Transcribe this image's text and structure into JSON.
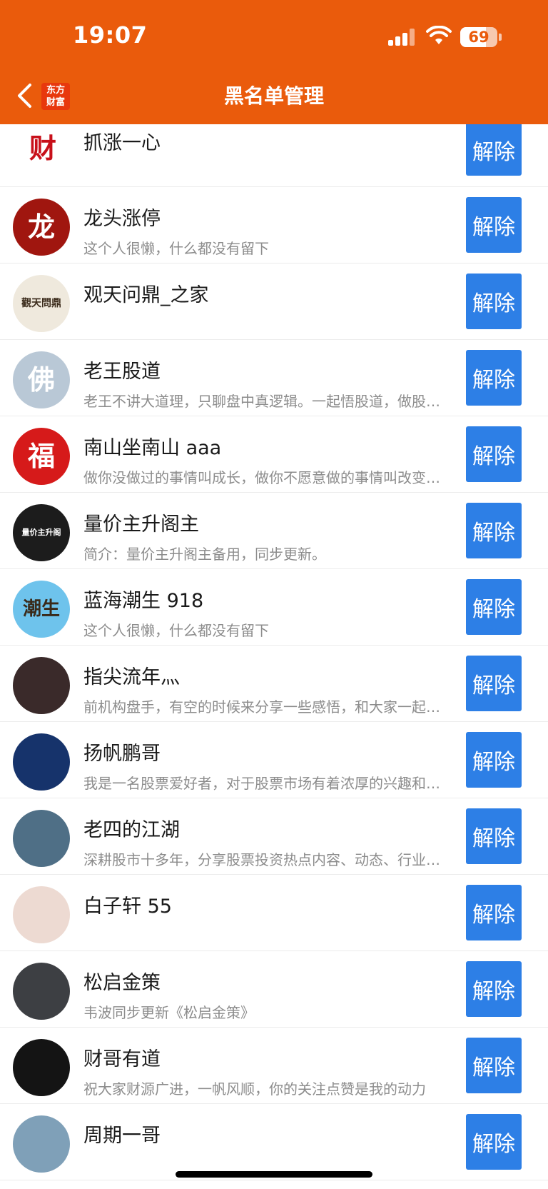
{
  "status_bar": {
    "time": "19:07",
    "battery": "69",
    "battery_level": 0.69
  },
  "header": {
    "title": "黑名单管理",
    "logo_line1": "东方",
    "logo_line2": "财富",
    "brand_color": "#ea5b0c"
  },
  "colors": {
    "button": "#2d7fe6",
    "desc_text": "#8c8c8c"
  },
  "unblock_label": "解除",
  "users": [
    {
      "name": "抓涨一心",
      "desc": "",
      "avatar_text": "财",
      "avatar_color": "#ffffff"
    },
    {
      "name": "龙头涨停",
      "desc": "这个人很懒，什么都没有留下",
      "avatar_text": "龙",
      "avatar_color": "#a0160f"
    },
    {
      "name": "观天问鼎_之家",
      "desc": "",
      "avatar_text": "觀天問鼎",
      "avatar_color": "#efe9dd"
    },
    {
      "name": "老王股道",
      "desc": "老王不讲大道理，只聊盘中真逻辑。一起悟股道，做股市中的明白人。",
      "avatar_text": "佛",
      "avatar_color": "#b9c8d6"
    },
    {
      "name": "南山坐南山 aaa",
      "desc": "做你没做过的事情叫成长，做你不愿意做的事情叫改变，做你不敢做的事情叫突破。",
      "avatar_text": "福",
      "avatar_color": "#d61a1a"
    },
    {
      "name": "量价主升阁主",
      "desc": "简介：量价主升阁主备用，同步更新。",
      "avatar_text": "量价主升阁",
      "avatar_color": "#1c1c1c"
    },
    {
      "name": "蓝海潮生 918",
      "desc": "这个人很懒，什么都没有留下",
      "avatar_text": "潮生",
      "avatar_color": "#6ec3ec"
    },
    {
      "name": "指尖流年灬",
      "desc": "前机构盘手，有空的时候来分享一些感悟，和大家一起交流。",
      "avatar_text": "",
      "avatar_color": "#3a2a2a"
    },
    {
      "name": "扬帆鹏哥",
      "desc": "我是一名股票爱好者，对于股票市场有着浓厚的兴趣和热情。",
      "avatar_text": "",
      "avatar_color": "#16336b"
    },
    {
      "name": "老四的江湖",
      "desc": "深耕股市十多年，分享股票投资热点内容、动态、行业研究。",
      "avatar_text": "",
      "avatar_color": "#4f6f86"
    },
    {
      "name": "白子轩 55",
      "desc": "",
      "avatar_text": "",
      "avatar_color": "#eddad2"
    },
    {
      "name": "松启金策",
      "desc": "韦波同步更新《松启金策》",
      "avatar_text": "",
      "avatar_color": "#3d3f43"
    },
    {
      "name": "财哥有道",
      "desc": "祝大家财源广进，一帆风顺，你的关注点赞是我的动力",
      "avatar_text": "",
      "avatar_color": "#141414"
    },
    {
      "name": "周期一哥",
      "desc": "",
      "avatar_text": "",
      "avatar_color": "#7fa0b8"
    }
  ]
}
